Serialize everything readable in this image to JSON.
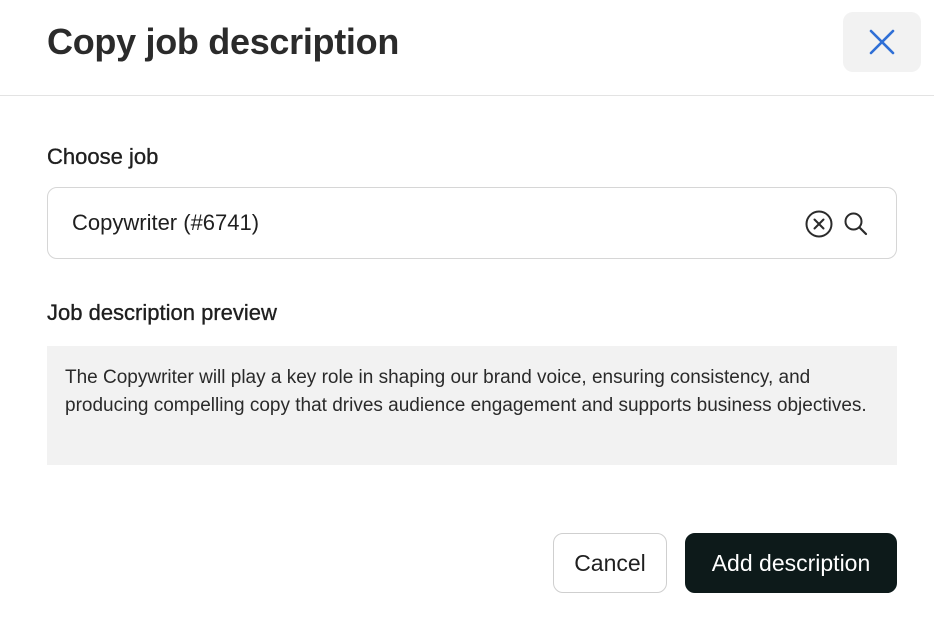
{
  "dialog": {
    "title": "Copy job description",
    "close_icon": "close-icon",
    "accent_color": "#2f6fd6"
  },
  "choose_job": {
    "label": "Choose job",
    "value": "Copywriter (#6741)",
    "clear_icon": "clear-circle-icon",
    "search_icon": "search-icon"
  },
  "preview": {
    "label": "Job description preview",
    "text": "The Copywriter will play a key role in shaping our brand voice, ensuring consistency, and producing compelling copy that drives audience engagement and supports business objectives."
  },
  "footer": {
    "cancel_label": "Cancel",
    "add_label": "Add description",
    "primary_color": "#0d1a1a"
  }
}
